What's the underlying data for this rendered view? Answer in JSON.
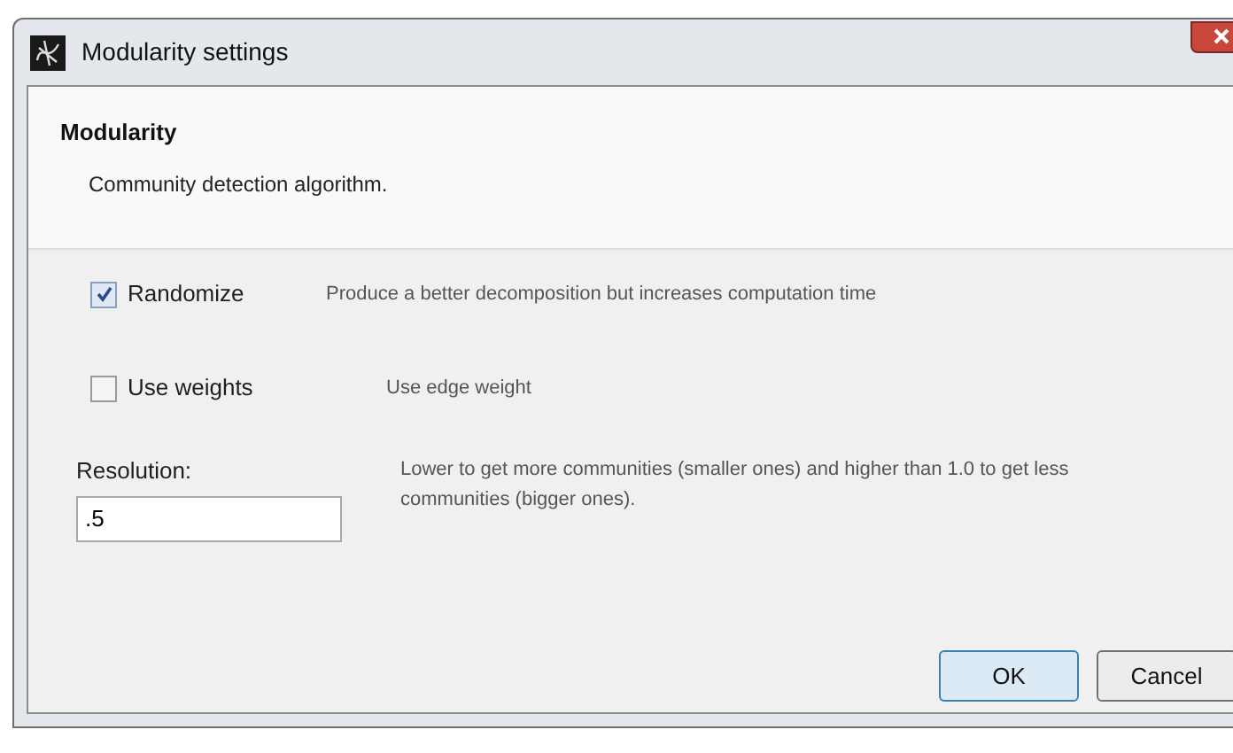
{
  "window": {
    "title": "Modularity settings"
  },
  "header": {
    "title": "Modularity",
    "description": "Community detection algorithm."
  },
  "options": [
    {
      "kind": "checkbox",
      "label": "Randomize",
      "checked": true,
      "hint": "Produce a better decomposition but increases computation time"
    },
    {
      "kind": "checkbox",
      "label": "Use weights",
      "checked": false,
      "hint": "Use edge weight"
    },
    {
      "kind": "number",
      "label": "Resolution:",
      "value": ".5",
      "hint": "Lower to get more communities (smaller ones) and higher than 1.0 to get less communities (bigger ones)."
    }
  ],
  "buttons": [
    {
      "label": "OK",
      "default": true
    },
    {
      "label": "Cancel",
      "default": false
    }
  ]
}
